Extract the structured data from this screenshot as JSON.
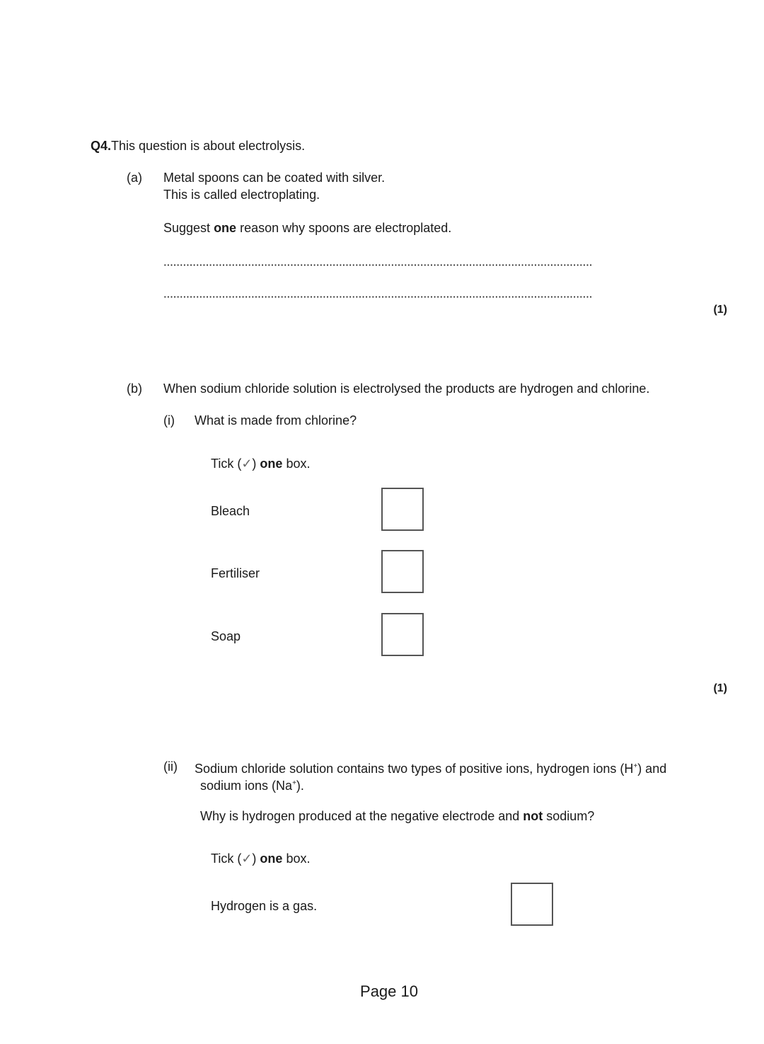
{
  "question": {
    "number": "Q4.",
    "intro": "This question is about electrolysis."
  },
  "part_a": {
    "label": "(a)",
    "line1": "Metal spoons can be coated with silver.",
    "line2": "This is called electroplating.",
    "prompt_pre": "Suggest ",
    "prompt_bold": "one",
    "prompt_post": " reason why spoons are electroplated.",
    "marks": "(1)"
  },
  "part_b": {
    "label": "(b)",
    "stem": "When sodium chloride solution is electrolysed the products are hydrogen and chlorine.",
    "sub_i": {
      "label": "(i)",
      "question": "What is made from chlorine?",
      "instruction_pre": "Tick (",
      "tick_glyph": "✓",
      "instruction_mid": ") ",
      "instruction_bold": "one",
      "instruction_post": " box.",
      "options": [
        "Bleach",
        "Fertiliser",
        "Soap"
      ],
      "marks": "(1)"
    },
    "sub_ii": {
      "label": "(ii)",
      "line1_pre": "Sodium chloride solution contains two types of positive ions, hydrogen ions (H",
      "line1_sup": "+",
      "line1_post": ") and",
      "line2_pre": "sodium ions (Na",
      "line2_sup": "+",
      "line2_post": ").",
      "question_pre": "Why is hydrogen produced at the negative electrode and ",
      "question_bold": "not",
      "question_post": " sodium?",
      "instruction_pre": "Tick (",
      "tick_glyph": "✓",
      "instruction_mid": ") ",
      "instruction_bold": "one",
      "instruction_post": " box.",
      "options": [
        "Hydrogen is a gas."
      ]
    }
  },
  "footer": {
    "page_label": "Page 10"
  }
}
